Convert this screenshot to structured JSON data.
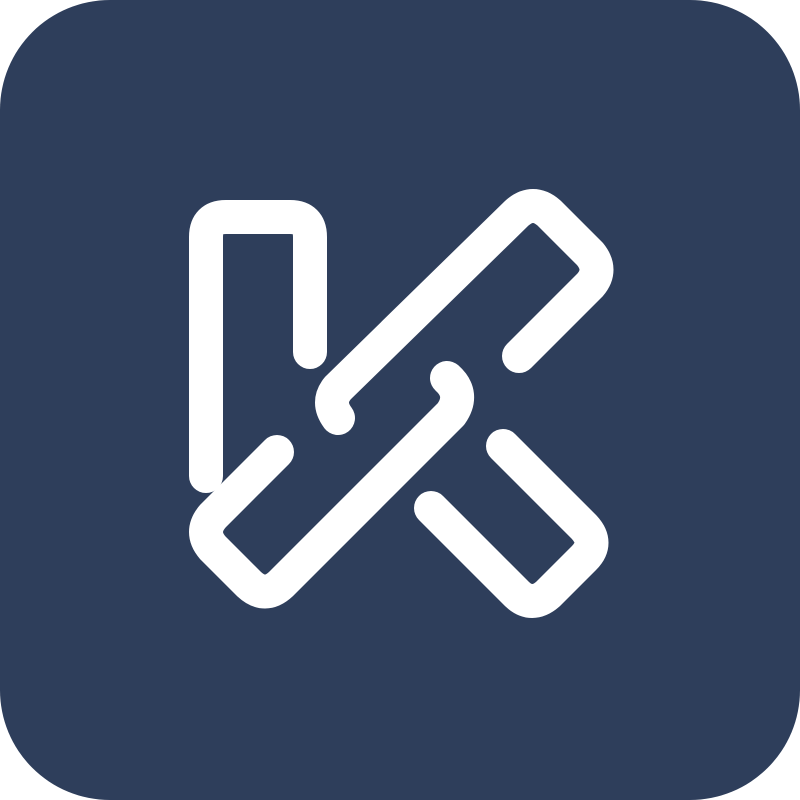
{
  "icon": {
    "name": "link-chain-k-logo-icon",
    "background_color": "#2E3E5B",
    "glyph_color": "#FFFFFF"
  }
}
